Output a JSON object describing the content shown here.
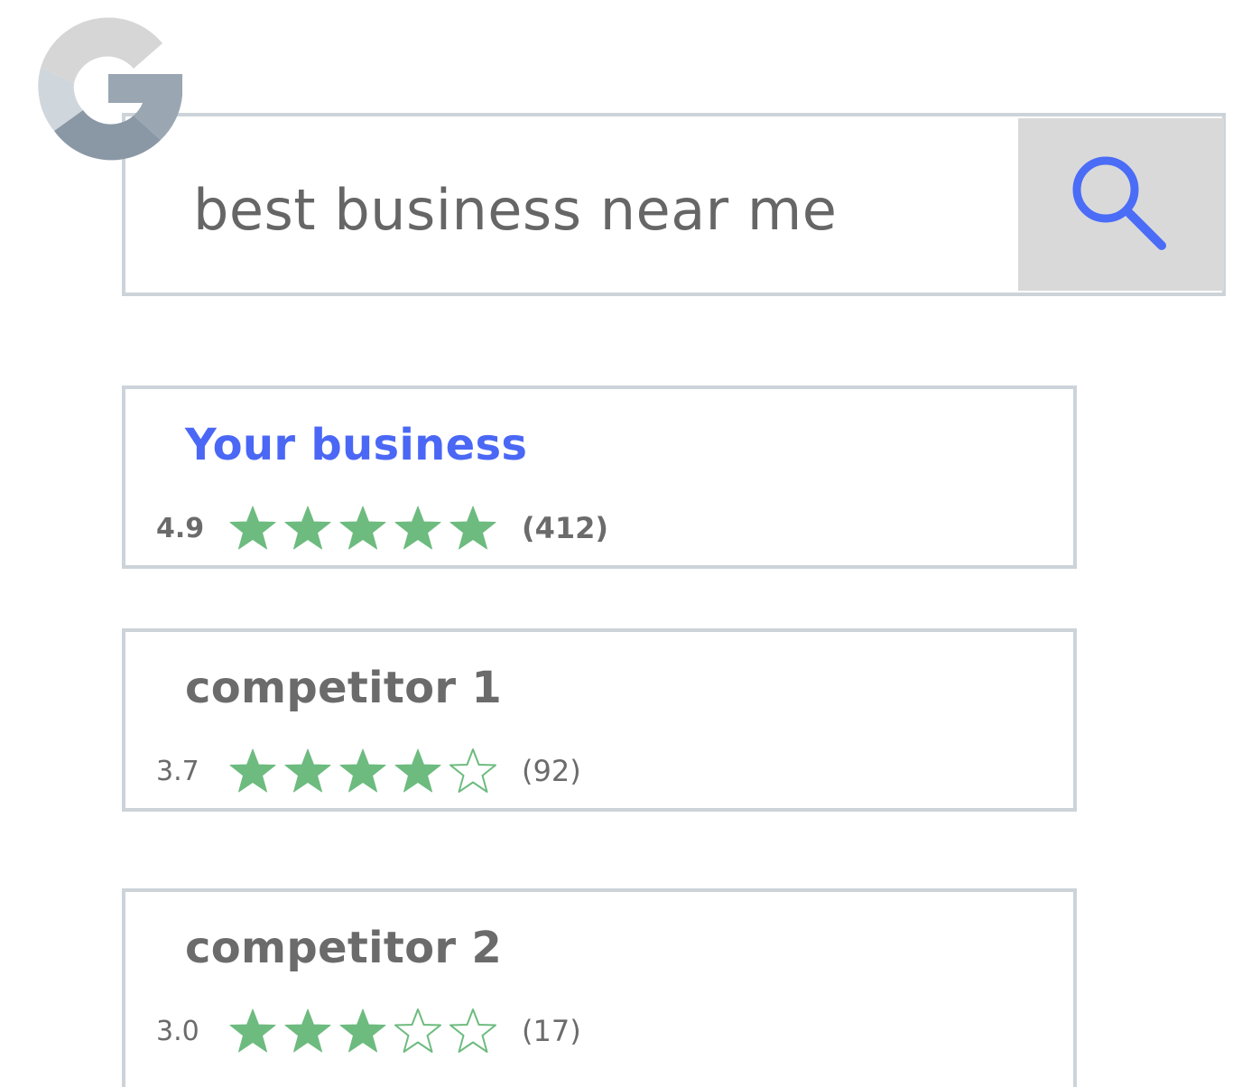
{
  "logo": {
    "icon": "google-g-logo"
  },
  "search": {
    "query": "best business near me",
    "button_icon": "search-icon",
    "accent_color": "#4a6cf7"
  },
  "results": [
    {
      "title": "Your business",
      "rating": "4.9",
      "stars_filled": 5,
      "stars_total": 5,
      "reviews": "(412)"
    },
    {
      "title": "competitor 1",
      "rating": "3.7",
      "stars_filled": 4,
      "stars_total": 5,
      "reviews": "(92)"
    },
    {
      "title": "competitor 2",
      "rating": "3.0",
      "stars_filled": 3,
      "stars_total": 5,
      "reviews": "(17)"
    }
  ],
  "colors": {
    "star_green": "#6dbb7f",
    "border": "#ccd3d9",
    "title_primary": "#4a67f5",
    "text_muted": "#6b6b6b",
    "search_button_bg": "#d9d9d9"
  }
}
